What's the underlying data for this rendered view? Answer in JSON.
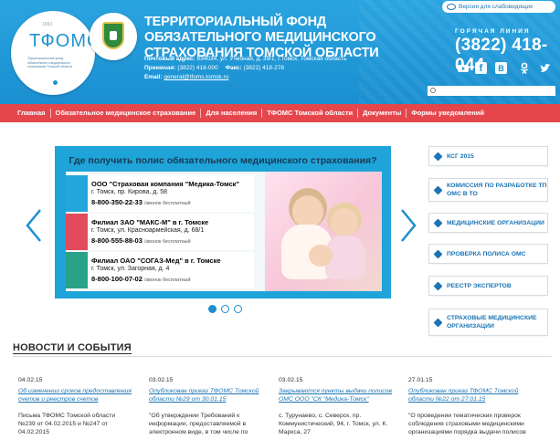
{
  "header": {
    "logo": {
      "year": "1993",
      "abbr": "ТФОМС",
      "caption": "Территориальный фонд обязательного медицинского страхования Томской области"
    },
    "title": "Территориальный фонд обязательного медицинского страхования Томской области",
    "contacts": {
      "address_label": "Почтовый адрес:",
      "address": "634034, ул. Учебная, д. 39/1, г.Томск, Томская область",
      "reception_label": "Приемная:",
      "reception": "(3822) 418-000",
      "fax_label": "Факс:",
      "fax": "(3822) 418-278",
      "email_label": "Email:",
      "email": "general@tfoms.tomsk.ru"
    },
    "vision_button": "Версия для слабовидящих",
    "hotline_label": "ГОРЯЧАЯ ЛИНИЯ",
    "hotline_phone": "(3822) 418-044",
    "social": [
      "youtube-icon",
      "facebook-icon",
      "vk-icon",
      "odnoklassniki-icon",
      "twitter-icon"
    ],
    "search_placeholder": ""
  },
  "nav": {
    "items": [
      "Главная",
      "Обязательное медицинское страхование",
      "Для населения",
      "ТФОМС Томской области",
      "Документы",
      "Формы уведомлений"
    ]
  },
  "slider": {
    "title": "Где получить полис обязательного медицинского страхования?",
    "companies": [
      {
        "name": "ООО \"Страховая компания \"Медика-Томск\"",
        "address": "г. Томск, пр. Кирова, д. 58",
        "phone": "8-800-350-22-33",
        "phone_note": "/звонок бесплатный",
        "color": "#24a6dc"
      },
      {
        "name": "Филиал ЗАО \"МАКС-М\" в г. Томске",
        "address": "г. Томск, ул. Красноармейская, д. 68/1",
        "phone": "8-800-555-88-03",
        "phone_note": "/звонок бесплатный",
        "color": "#e24a5d"
      },
      {
        "name": "Филиал ОАО \"СОГАЗ-Мед\" в г. Томске",
        "address": "г. Томск, ул. Загорная, д. 4",
        "phone": "8-800-100-07-02",
        "phone_note": "/звонок бесплатный",
        "color": "#2aa28a"
      }
    ],
    "active_slide": 0,
    "slide_count": 3
  },
  "right_menu": {
    "items": [
      "КСГ 2015",
      "Комиссия по разработке ТП ОМС в ТО",
      "Медицинские организации",
      "Проверка полиса ОМС",
      "Реестр экспертов",
      "Страховые медицинские организации"
    ]
  },
  "news": {
    "heading": "Новости и события",
    "items": [
      {
        "date": "04.02.15",
        "title": "Об изменении сроков предоставления счетов и реестров счетов",
        "body": "Письма ТФОМС Томской области №239 от 04.02.2015 и №247 от 04.02.2015"
      },
      {
        "date": "03.02.15",
        "title": "Опубликован приказ ТФОМС Томской области №29 от 30.01.15",
        "body": "\"Об утверждении Требований к информации, предоставляемой в электронном виде, в том числе по"
      },
      {
        "date": "03.02.15",
        "title": "Закрываются пункты выдачи полисов ОМС ООО \"СК \"Медика-Томск\"",
        "body": "с. Туруна­ево, с. Северск, пр. Коммунистический, 94, г. Томск, ул. К. Маркса, 27"
      },
      {
        "date": "27.01.15",
        "title": "Опубликован приказ ТФОМС Томской области №22 от 27.01.15",
        "body": "\"О проведении тематических проверок соблюдения страховыми медицинскими организациями порядка выдачи полисов"
      }
    ]
  },
  "colors": {
    "header_blue": "#1e93d3",
    "nav_red": "#e5464c",
    "link_blue": "#1b74b3"
  }
}
